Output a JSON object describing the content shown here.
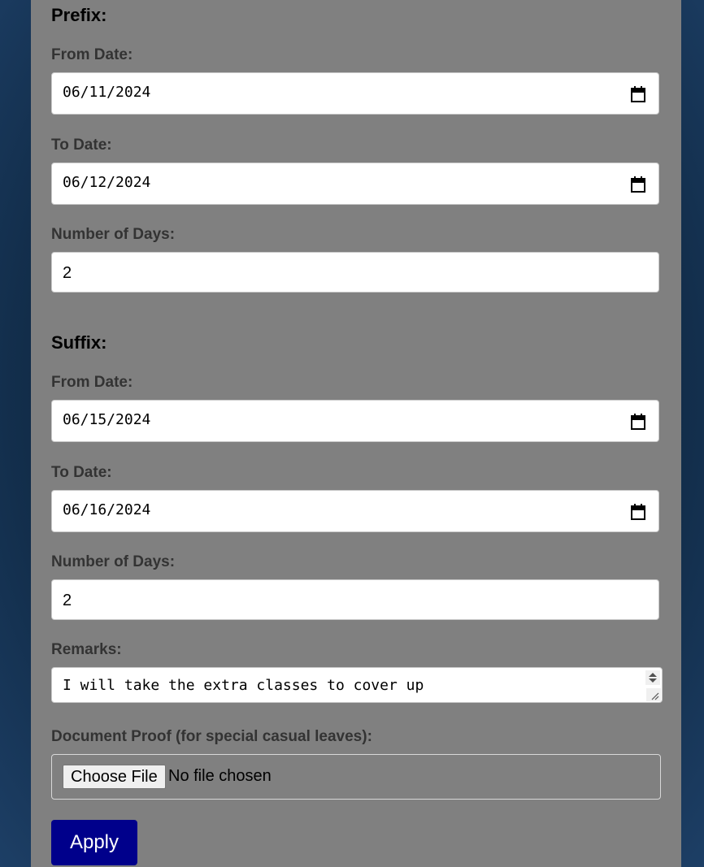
{
  "prefix": {
    "title": "Prefix:",
    "from_label": "From Date:",
    "from_value": "06/11/2024",
    "to_label": "To Date:",
    "to_value": "06/12/2024",
    "days_label": "Number of Days:",
    "days_value": "2"
  },
  "suffix": {
    "title": "Suffix:",
    "from_label": "From Date:",
    "from_value": "06/15/2024",
    "to_label": "To Date:",
    "to_value": "06/16/2024",
    "days_label": "Number of Days:",
    "days_value": "2"
  },
  "remarks": {
    "label": "Remarks:",
    "value": "I will take the extra classes to cover up"
  },
  "document": {
    "label": "Document Proof (for special casual leaves):",
    "button_label": "Choose File",
    "status": "No file chosen"
  },
  "apply_label": "Apply",
  "colors": {
    "panel": "#808080",
    "apply_button": "#00008b",
    "label_text": "#333333"
  },
  "icons": {
    "date_picker": "calendar-icon",
    "textarea_spinner": "spinner-arrows-icon",
    "textarea_resize": "resize-handle-icon"
  }
}
